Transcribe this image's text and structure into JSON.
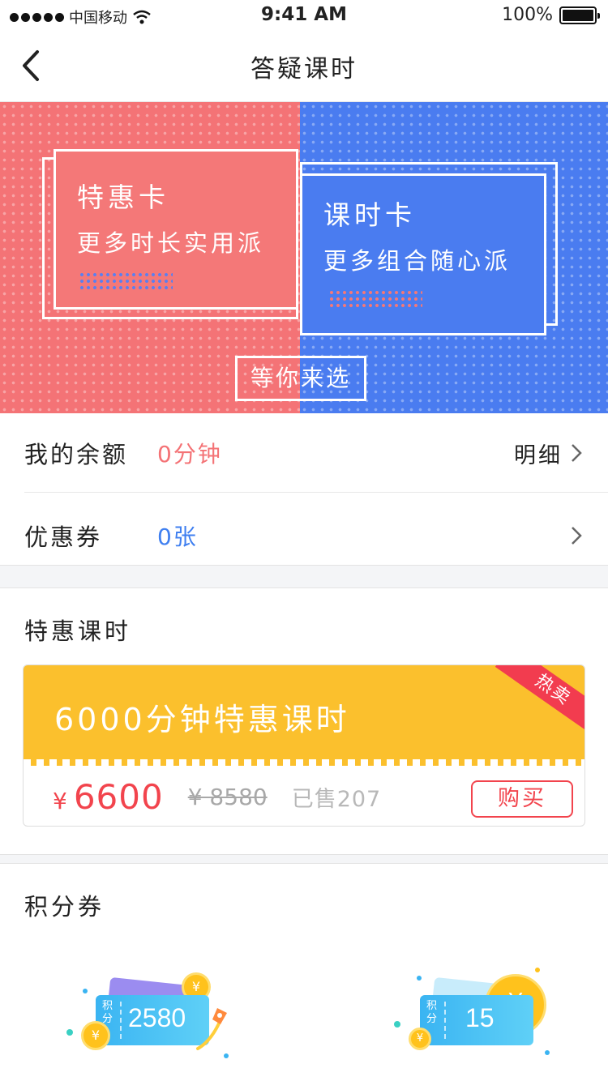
{
  "status_bar": {
    "carrier": "中国移动",
    "time": "9:41 AM",
    "battery": "100%"
  },
  "nav": {
    "title": "答疑课时"
  },
  "banner": {
    "left_card": {
      "title": "特惠卡",
      "subtitle": "更多时长实用派"
    },
    "right_card": {
      "title": "课时卡",
      "subtitle": "更多组合随心派"
    },
    "tag": "等你来选"
  },
  "balance": {
    "rows": [
      {
        "label": "我的余额",
        "value": "0分钟",
        "value_color": "#f47376",
        "action": "明细"
      },
      {
        "label": "优惠券",
        "value": "0张",
        "value_color": "#3f7ff0",
        "action": ""
      }
    ]
  },
  "deals": {
    "title": "特惠课时",
    "item": {
      "name": "6000分钟特惠课时",
      "ribbon": "热卖",
      "currency": "¥",
      "price": "6600",
      "original_price": "¥ 8580",
      "sold": "已售207",
      "buy_label": "购买"
    }
  },
  "coupons": {
    "title": "积分券",
    "items": [
      {
        "tag": "积分",
        "amount": "2580",
        "coin": "¥"
      },
      {
        "tag": "积分",
        "amount": "15",
        "coin": "¥"
      }
    ]
  },
  "colors": {
    "accent_red": "#f2444d",
    "banner_red": "#f47376",
    "banner_blue": "#4a7cf0",
    "deal_yellow": "#fbc02d"
  }
}
